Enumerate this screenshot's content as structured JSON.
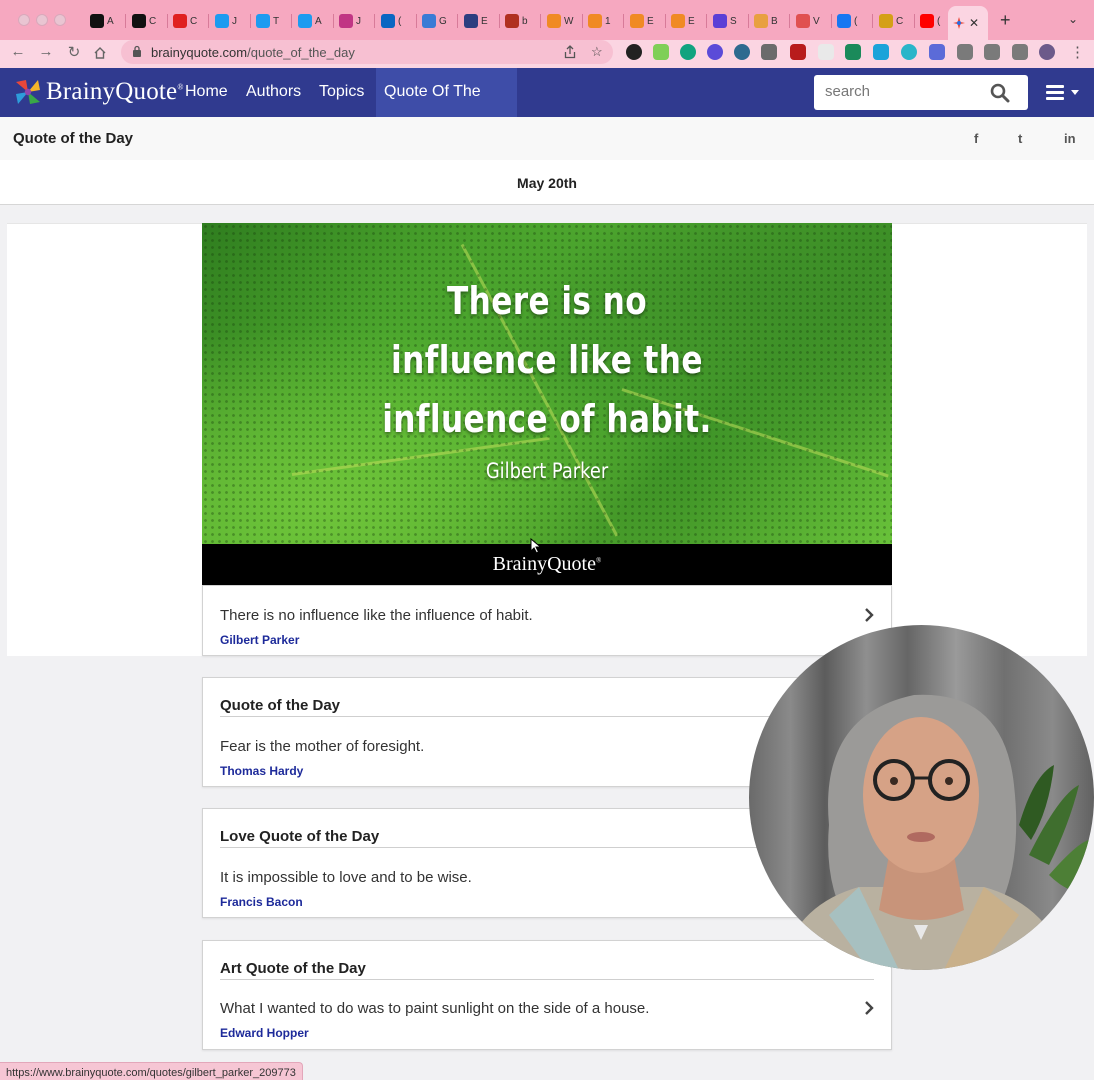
{
  "browser": {
    "tabs": [
      {
        "letter": "A",
        "color": "#111111"
      },
      {
        "letter": "C",
        "color": "#111111"
      },
      {
        "letter": "C",
        "color": "#e02020"
      },
      {
        "letter": "J",
        "color": "#1d9bf0"
      },
      {
        "letter": "T",
        "color": "#1d9bf0"
      },
      {
        "letter": "A",
        "color": "#1d9bf0"
      },
      {
        "letter": "J",
        "color": "#c13584"
      },
      {
        "letter": "(",
        "color": "#0a66c2"
      },
      {
        "letter": "G",
        "color": "#3a7bd5"
      },
      {
        "letter": "E",
        "color": "#2c3e80"
      },
      {
        "letter": "b",
        "color": "#b03020"
      },
      {
        "letter": "W",
        "color": "#f08a24"
      },
      {
        "letter": "1",
        "color": "#f08a24"
      },
      {
        "letter": "E",
        "color": "#f08a24"
      },
      {
        "letter": "E",
        "color": "#f08a24"
      },
      {
        "letter": "S",
        "color": "#5b3fd6"
      },
      {
        "letter": "B",
        "color": "#e8a040"
      },
      {
        "letter": "V",
        "color": "#e05050"
      },
      {
        "letter": "(",
        "color": "#1877f2"
      },
      {
        "letter": "C",
        "color": "#d4a017"
      },
      {
        "letter": "(",
        "color": "#ff0000"
      }
    ],
    "active_tab_close": "✕",
    "new_tab": "+",
    "tab_menu": "⌄",
    "url_host": "brainyquote.com",
    "url_path": "/quote_of_the_day",
    "status_url": "https://www.brainyquote.com/quotes/gilbert_parker_209773"
  },
  "site": {
    "logo": "BrainyQuote",
    "logo_mark": "®",
    "nav": [
      "Home",
      "Authors",
      "Topics",
      "Quote Of The Day"
    ],
    "search_placeholder": "search"
  },
  "page": {
    "title": "Quote of the Day",
    "share": [
      "f",
      "t",
      "in"
    ],
    "date": "May 20th"
  },
  "hero": {
    "lines": [
      "There is no",
      "influence like the",
      "influence of habit."
    ],
    "author": "Gilbert Parker",
    "brand": "BrainyQuote",
    "brand_mark": "®"
  },
  "cards": [
    {
      "title": "",
      "quote": "There is no influence like the influence of habit.",
      "author": "Gilbert Parker"
    },
    {
      "title": "Quote of the Day",
      "quote": "Fear is the mother of foresight.",
      "author": "Thomas Hardy"
    },
    {
      "title": "Love Quote of the Day",
      "quote": "It is impossible to love and to be wise.",
      "author": "Francis Bacon"
    },
    {
      "title": "Art Quote of the Day",
      "quote": "What I wanted to do was to paint sunlight on the side of a house.",
      "author": "Edward Hopper"
    }
  ],
  "colors": {
    "nav_bg": "#303a8f",
    "nav_active": "#3e4da8",
    "author_link": "#1d2a9a",
    "browser_frame": "#f6a8c0"
  }
}
